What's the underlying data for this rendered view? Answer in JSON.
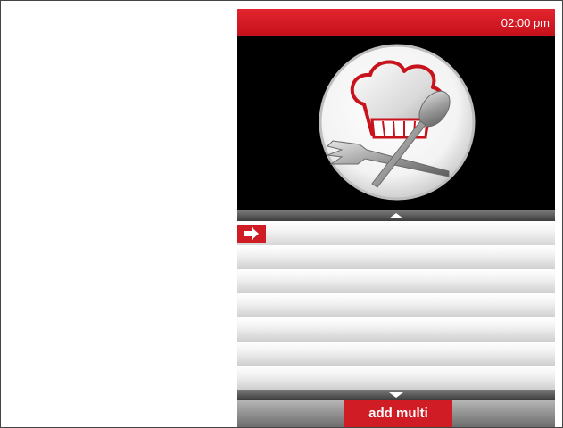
{
  "status_bar": {
    "time": "02:00 pm"
  },
  "logo": {
    "icon": "chef-hat-fork-spoon-icon"
  },
  "list": {
    "rows": [
      "",
      "",
      "",
      "",
      "",
      "",
      ""
    ],
    "selected_index": 0,
    "selected_icon": "arrow-right-icon"
  },
  "bottom_bar": {
    "primary_label": "add multi"
  },
  "colors": {
    "accent": "#d01c24",
    "background": "#000000"
  }
}
